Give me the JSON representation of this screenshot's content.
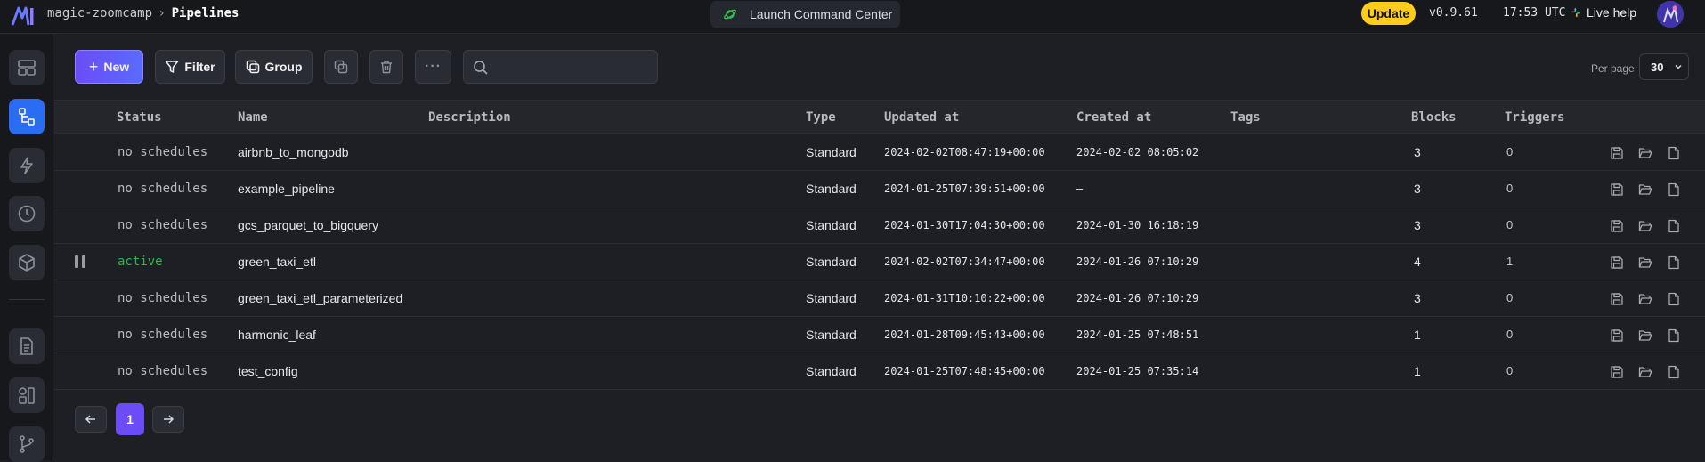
{
  "header": {
    "project": "magic-zoomcamp",
    "page": "Pipelines",
    "command_center": "Launch Command Center",
    "update_label": "Update",
    "version": "v0.9.61",
    "time": "17:53 UTC",
    "live_help": "Live help"
  },
  "toolbar": {
    "new_label": "New",
    "filter_label": "Filter",
    "group_label": "Group",
    "search_placeholder": "",
    "per_page_label": "Per page",
    "per_page_value": "30"
  },
  "table": {
    "columns": [
      "Status",
      "Name",
      "Description",
      "Type",
      "Updated at",
      "Created at",
      "Tags",
      "Blocks",
      "Triggers"
    ],
    "rows": [
      {
        "status": "no schedules",
        "name": "airbnb_to_mongodb",
        "description": "",
        "type": "Standard",
        "updated": "2024-02-02T08:47:19+00:00",
        "created": "2024-02-02 08:05:02",
        "tags": "",
        "blocks": "3",
        "triggers": "0",
        "active": false
      },
      {
        "status": "no schedules",
        "name": "example_pipeline",
        "description": "",
        "type": "Standard",
        "updated": "2024-01-25T07:39:51+00:00",
        "created": "—",
        "tags": "",
        "blocks": "3",
        "triggers": "0",
        "active": false
      },
      {
        "status": "no schedules",
        "name": "gcs_parquet_to_bigquery",
        "description": "",
        "type": "Standard",
        "updated": "2024-01-30T17:04:30+00:00",
        "created": "2024-01-30 16:18:19",
        "tags": "",
        "blocks": "3",
        "triggers": "0",
        "active": false
      },
      {
        "status": "active",
        "name": "green_taxi_etl",
        "description": "",
        "type": "Standard",
        "updated": "2024-02-02T07:34:47+00:00",
        "created": "2024-01-26 07:10:29",
        "tags": "",
        "blocks": "4",
        "triggers": "1",
        "active": true
      },
      {
        "status": "no schedules",
        "name": "green_taxi_etl_parameterized",
        "description": "",
        "type": "Standard",
        "updated": "2024-01-31T10:10:22+00:00",
        "created": "2024-01-26 07:10:29",
        "tags": "",
        "blocks": "3",
        "triggers": "0",
        "active": false
      },
      {
        "status": "no schedules",
        "name": "harmonic_leaf",
        "description": "",
        "type": "Standard",
        "updated": "2024-01-28T09:45:43+00:00",
        "created": "2024-01-25 07:48:51",
        "tags": "",
        "blocks": "1",
        "triggers": "0",
        "active": false
      },
      {
        "status": "no schedules",
        "name": "test_config",
        "description": "",
        "type": "Standard",
        "updated": "2024-01-25T07:48:45+00:00",
        "created": "2024-01-25 07:35:14",
        "tags": "",
        "blocks": "1",
        "triggers": "0",
        "active": false
      }
    ]
  },
  "pagination": {
    "current_page": "1"
  },
  "colors": {
    "accent": "#6b4cf6",
    "update": "#ffcc19",
    "active_status": "#2ab84a",
    "sidebar_active": "#2b6cf5"
  }
}
